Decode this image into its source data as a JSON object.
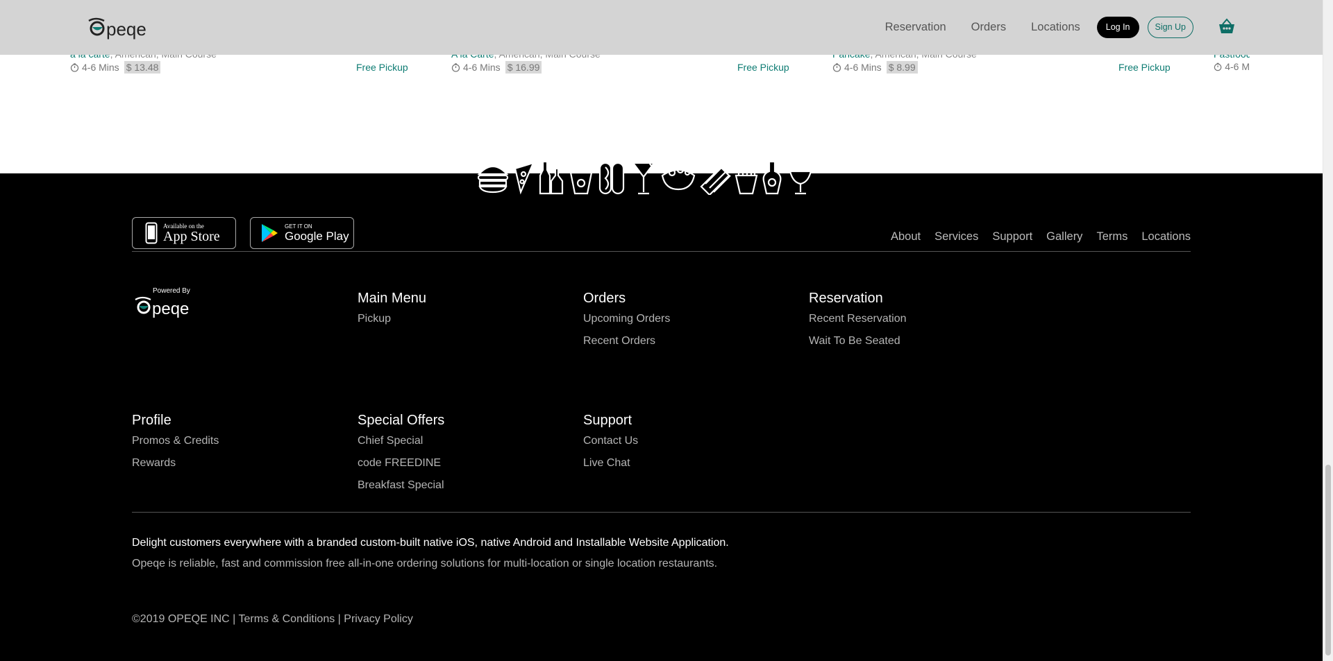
{
  "header": {
    "nav": [
      "Reservation",
      "Orders",
      "Locations"
    ],
    "login_label": "Log In",
    "signup_label": "Sign Up"
  },
  "cards": [
    {
      "category_first": "a la carte",
      "category_rest": ", American, Main Course",
      "time": "4-6 Mins",
      "price": "$ 13.48",
      "pickup": "Free Pickup"
    },
    {
      "category_first": "A la Carte",
      "category_rest": ", American, Main Course",
      "time": "4-6 Mins",
      "price": "$ 16.99",
      "pickup": "Free Pickup"
    },
    {
      "category_first": "Pancake",
      "category_rest": ", American, Main Course",
      "time": "4-6 Mins",
      "price": "$ 8.99",
      "pickup": "Free Pickup"
    },
    {
      "category_first": "Fastfood",
      "category_rest": "",
      "time": "4-6 M",
      "price": "",
      "pickup": ""
    }
  ],
  "apps": {
    "apple_small": "Available on the",
    "apple_big": "App Store",
    "google_small": "GET IT ON",
    "google_big": "Google Play"
  },
  "footer_links": [
    "About",
    "Services",
    "Support",
    "Gallery",
    "Terms",
    "Locations"
  ],
  "powered_by": "Powered By",
  "columns": [
    {
      "title": "Main Menu",
      "items": [
        "Pickup"
      ]
    },
    {
      "title": "Orders",
      "items": [
        "Upcoming Orders",
        "Recent Orders"
      ]
    },
    {
      "title": "Reservation",
      "items": [
        "Recent Reservation",
        "Wait To Be Seated"
      ]
    },
    {
      "title": "Profile",
      "items": [
        "Promos & Credits",
        "Rewards"
      ]
    },
    {
      "title": "Special Offers",
      "items": [
        "Chief Special",
        "code FREEDINE",
        "Breakfast Special"
      ]
    },
    {
      "title": "Support",
      "items": [
        "Contact Us",
        "Live Chat"
      ]
    }
  ],
  "tagline": "Delight customers everywhere with a branded custom-built native iOS, native Android and Installable Website Application.",
  "subline": "Opeqe is reliable, fast and commission free all-in-one ordering solutions for multi-location or single location restaurants.",
  "copyright": {
    "prefix": "©2019 OPEQE INC",
    "sep": " | ",
    "terms": "Terms & Conditions",
    "privacy": "Privacy Policy"
  },
  "brand": {
    "accent": "#0e7c73",
    "footer_bg": "#000000",
    "header_bg": "#d4d4d4"
  }
}
